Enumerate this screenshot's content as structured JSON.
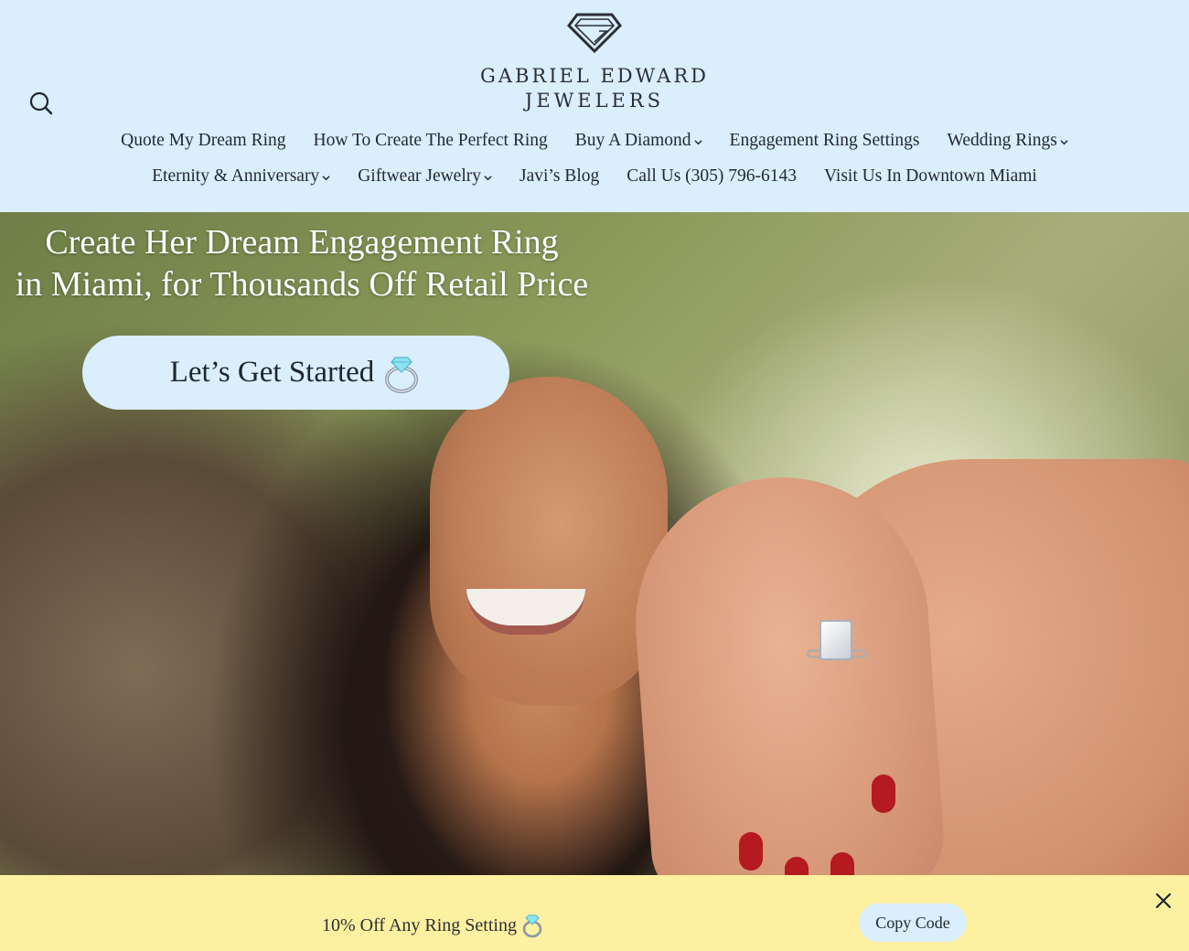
{
  "header": {
    "logo": {
      "line1": "GABRIEL EDWARD",
      "line2": "JEWELERS",
      "mark_icon": "diamond-logo-icon"
    },
    "search_icon": "search-icon",
    "nav_row1": [
      {
        "label": "Quote My Dream Ring",
        "dropdown": false
      },
      {
        "label": "How To Create The Perfect Ring",
        "dropdown": false
      },
      {
        "label": "Buy A Diamond",
        "dropdown": true
      },
      {
        "label": "Engagement Ring Settings",
        "dropdown": false
      },
      {
        "label": "Wedding Rings",
        "dropdown": true
      }
    ],
    "nav_row2": [
      {
        "label": "Eternity & Anniversary",
        "dropdown": true
      },
      {
        "label": "Giftwear Jewelry",
        "dropdown": true
      },
      {
        "label": "Javi’s Blog",
        "dropdown": false
      },
      {
        "label": "Call Us (305) 796-6143",
        "dropdown": false
      },
      {
        "label": "Visit Us In Downtown Miami",
        "dropdown": false
      }
    ]
  },
  "hero": {
    "title_line1": "Create Her Dream Engagement Ring",
    "title_line2": "in Miami, for Thousands Off Retail Price",
    "cta_label": "Let’s Get Started",
    "cta_icon": "ring-icon"
  },
  "promo": {
    "text": "10% Off Any Ring Setting",
    "icon": "ring-icon",
    "copy_label": "Copy Code",
    "close_icon": "close-icon"
  },
  "colors": {
    "header_bg": "#daeefc",
    "promo_bg": "#fdf0a0",
    "button_bg": "#daeefc",
    "text_dark": "#222a33"
  }
}
